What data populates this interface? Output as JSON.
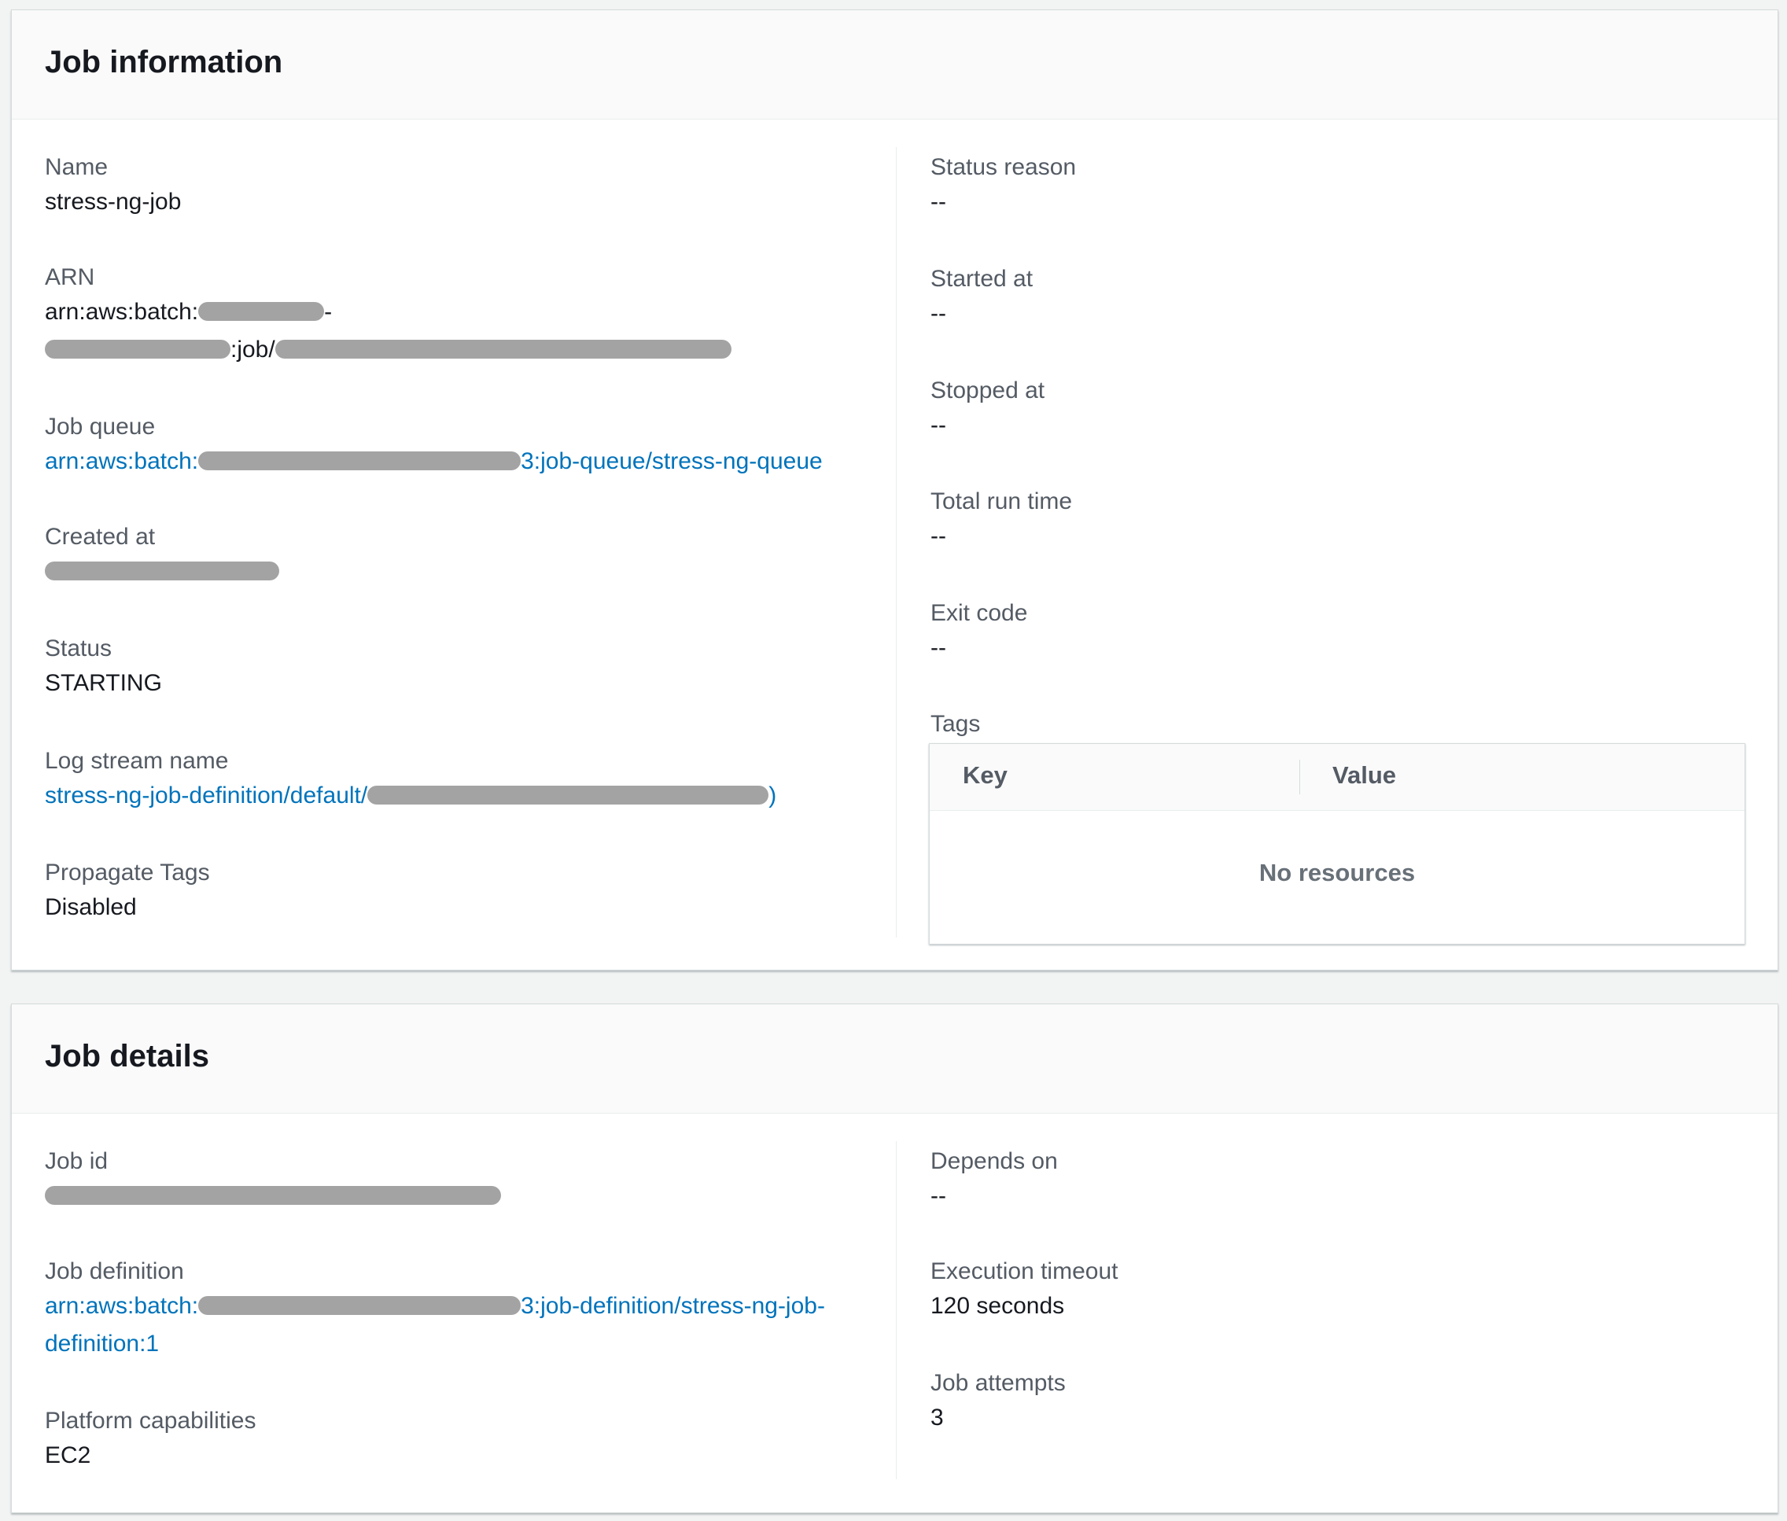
{
  "job_information": {
    "title": "Job information",
    "left": {
      "name": {
        "label": "Name",
        "value": "stress-ng-job"
      },
      "arn": {
        "label": "ARN",
        "line1_prefix": "arn:aws:batch:",
        "line1_suffix": "-",
        "line2_mid": ":job/"
      },
      "job_queue": {
        "label": "Job queue",
        "prefix": "arn:aws:batch:",
        "suffix": "3:job-queue/stress-ng-queue"
      },
      "created_at": {
        "label": "Created at"
      },
      "status": {
        "label": "Status",
        "value": "STARTING"
      },
      "log_stream_name": {
        "label": "Log stream name",
        "prefix": "stress-ng-job-definition/default/",
        "suffix": ")"
      },
      "propagate_tags": {
        "label": "Propagate Tags",
        "value": "Disabled"
      }
    },
    "right": {
      "status_reason": {
        "label": "Status reason",
        "value": "--"
      },
      "started_at": {
        "label": "Started at",
        "value": "--"
      },
      "stopped_at": {
        "label": "Stopped at",
        "value": "--"
      },
      "total_run_time": {
        "label": "Total run time",
        "value": "--"
      },
      "exit_code": {
        "label": "Exit code",
        "value": "--"
      },
      "tags": {
        "label": "Tags",
        "columns": [
          "Key",
          "Value"
        ],
        "empty_message": "No resources"
      }
    }
  },
  "job_details": {
    "title": "Job details",
    "left": {
      "job_id": {
        "label": "Job id"
      },
      "job_definition": {
        "label": "Job definition",
        "prefix": "arn:aws:batch:",
        "suffix": "3:job-definition/stress-ng-job-",
        "line2": "definition:1"
      },
      "platform_capabilities": {
        "label": "Platform capabilities",
        "value": "EC2"
      }
    },
    "right": {
      "depends_on": {
        "label": "Depends on",
        "value": "--"
      },
      "execution_timeout": {
        "label": "Execution timeout",
        "value": "120 seconds"
      },
      "job_attempts": {
        "label": "Job attempts",
        "value": "3"
      }
    }
  },
  "colors": {
    "link": "#0073bb",
    "label": "#545b64",
    "text": "#16191f",
    "redaction": "#a3a3a3"
  }
}
